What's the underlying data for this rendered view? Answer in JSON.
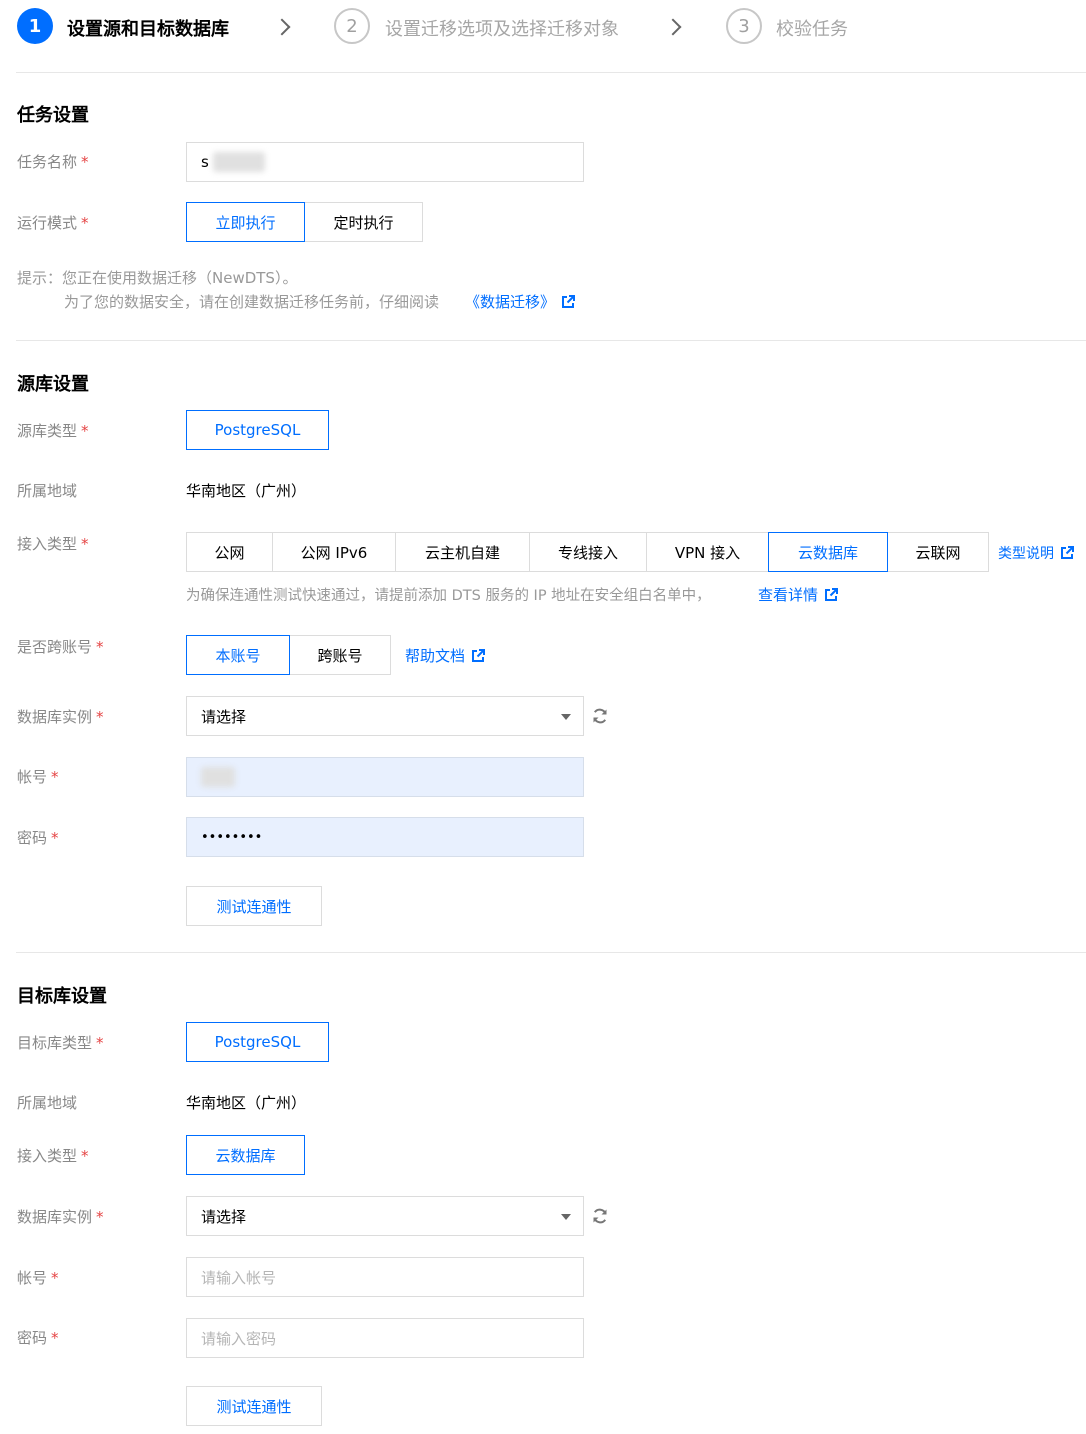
{
  "stepper": {
    "steps": [
      {
        "number": "1",
        "label": "设置源和目标数据库"
      },
      {
        "number": "2",
        "label": "设置迁移选项及选择迁移对象"
      },
      {
        "number": "3",
        "label": "校验任务"
      }
    ]
  },
  "task": {
    "section_title": "任务设置",
    "name_label": "任务名称",
    "name_value": "s",
    "mode_label": "运行模式",
    "mode_options": [
      "立即执行",
      "定时执行"
    ],
    "tip_line1": "提示：您正在使用数据迁移（NewDTS）。",
    "tip_line2_prefix": "为了您的数据安全，请在创建数据迁移任务前，仔细阅读",
    "tip_link": "《数据迁移》"
  },
  "source": {
    "section_title": "源库设置",
    "db_type_label": "源库类型",
    "db_type_value": "PostgreSQL",
    "region_label": "所属地域",
    "region_value": "华南地区（广州）",
    "access_label": "接入类型",
    "access_options": [
      "公网",
      "公网 IPv6",
      "云主机自建",
      "专线接入",
      "VPN 接入",
      "云数据库",
      "云联网"
    ],
    "access_help_link": "类型说明",
    "access_hint": "为确保连通性测试快速通过，请提前添加 DTS 服务的 IP 地址在安全组白名单中，",
    "access_hint_link": "查看详情",
    "cross_account_label": "是否跨账号",
    "cross_account_options": [
      "本账号",
      "跨账号"
    ],
    "help_doc_link": "帮助文档",
    "instance_label": "数据库实例",
    "instance_value": "请选择",
    "account_label": "帐号",
    "password_label": "密码",
    "password_value": "••••••••",
    "test_button": "测试连通性"
  },
  "target": {
    "section_title": "目标库设置",
    "db_type_label": "目标库类型",
    "db_type_value": "PostgreSQL",
    "region_label": "所属地域",
    "region_value": "华南地区（广州）",
    "access_label": "接入类型",
    "access_value": "云数据库",
    "instance_label": "数据库实例",
    "instance_value": "请选择",
    "account_label": "帐号",
    "account_placeholder": "请输入帐号",
    "password_label": "密码",
    "password_placeholder": "请输入密码",
    "test_button": "测试连通性"
  },
  "colors": {
    "primary": "#006eff",
    "required": "#e54545",
    "label": "#888888",
    "autofill": "#e8f0fe"
  }
}
